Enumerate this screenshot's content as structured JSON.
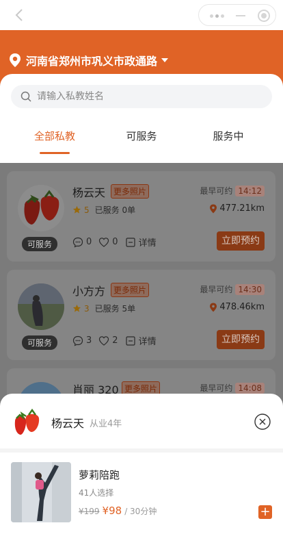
{
  "header": {
    "location": "河南省郑州市巩义市政通路"
  },
  "search": {
    "placeholder": "请输入私教姓名"
  },
  "tabs": [
    {
      "label": "全部私教",
      "active": true
    },
    {
      "label": "可服务",
      "active": false
    },
    {
      "label": "服务中",
      "active": false
    }
  ],
  "coaches": [
    {
      "name": "杨云天",
      "more_label": "更多照片",
      "earliest_label": "最早可约",
      "earliest_time": "14:12",
      "score": "5",
      "served": "已服务 0单",
      "distance": "477.21km",
      "status": "可服务",
      "comments": "0",
      "likes": "0",
      "detail_label": "详情",
      "book_label": "立即预约"
    },
    {
      "name": "小方方",
      "more_label": "更多照片",
      "earliest_label": "最早可约",
      "earliest_time": "14:30",
      "score": "3",
      "served": "已服务 5单",
      "distance": "478.46km",
      "status": "可服务",
      "comments": "3",
      "likes": "2",
      "detail_label": "详情",
      "book_label": "立即预约"
    },
    {
      "name": "肖丽 320",
      "more_label": "更多照片",
      "earliest_label": "最早可约",
      "earliest_time": "14:08"
    }
  ],
  "sheet": {
    "coach_name": "杨云天",
    "years": "从业4年",
    "item": {
      "title": "萝莉陪跑",
      "selected": "41人选择",
      "old_price": "¥199",
      "price": "¥98",
      "unit": "/ 30分钟"
    },
    "add_label": "+"
  },
  "colors": {
    "accent": "#e06326"
  }
}
